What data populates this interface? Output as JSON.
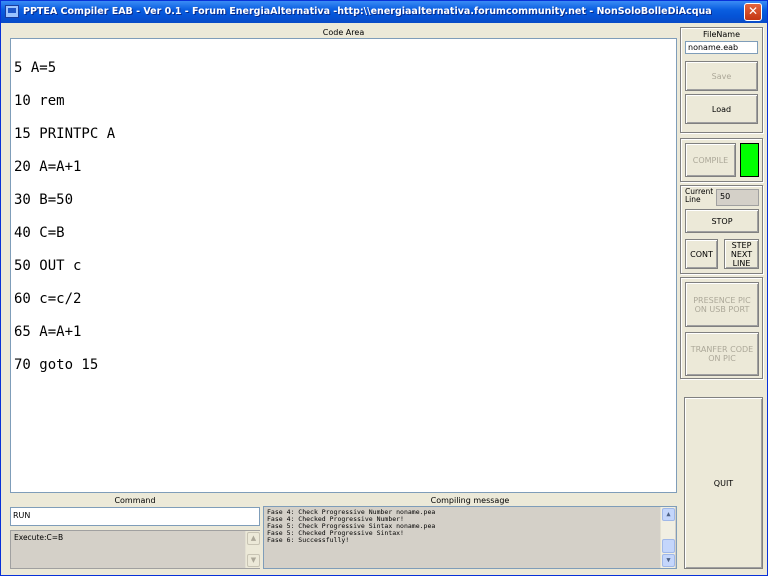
{
  "window": {
    "title": "PPTEA Compiler EAB - Ver 0.1 - Forum EnergiaAlternativa -http:\\\\energiaalternativa.forumcommunity.net  - NonSoloBolleDiAcqua",
    "close_glyph": "✕"
  },
  "code_area": {
    "label": "Code Area",
    "lines": [
      "5 A=5",
      "10 rem",
      "15 PRINTPC A",
      "20 A=A+1",
      "30 B=50",
      "40 C=B",
      "50 OUT c",
      "60 c=c/2",
      "65 A=A+1",
      "70 goto 15"
    ]
  },
  "file_panel": {
    "label": "FileName",
    "filename_value": "noname.eab",
    "save_label": "Save",
    "load_label": "Load"
  },
  "compile_panel": {
    "compile_label": "COMPILE",
    "status_color": "#00ff00"
  },
  "run_panel": {
    "current_line_label": "Current Line",
    "current_line_value": "50",
    "stop_label": "STOP",
    "cont_label": "CONT",
    "step_label": "STEP NEXT LINE"
  },
  "pic_panel": {
    "presence_label": "PRESENCE PIC ON USB PORT",
    "transfer_label": "TRANFER CODE ON PIC"
  },
  "quit_label": "QUIT",
  "command": {
    "label": "Command",
    "input_value": "RUN",
    "execute_text": "Execute:C=B"
  },
  "compiling": {
    "label": "Compiling message",
    "messages": [
      "Fase 4: Check Progressive Number noname.pea",
      "Fase 4: Checked Progressive Number!",
      "Fase 5: Check Progressive Sintax noname.pea",
      "Fase 5: Checked Progressive Sintax!",
      "Fase 6: Successfully!"
    ]
  },
  "colors": {
    "titlebar": "#0553d6",
    "window_bg": "#ece9d8",
    "disabled_text": "#aca899"
  },
  "icons": {
    "scroll_up": "▲",
    "scroll_down": "▼"
  }
}
